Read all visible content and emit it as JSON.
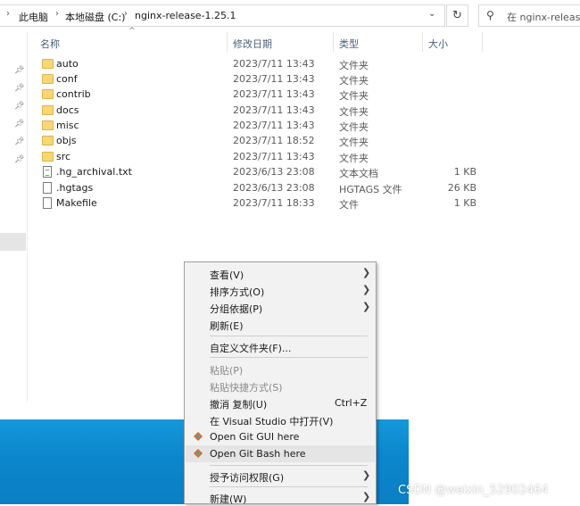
{
  "address": {
    "crumbs": [
      "此电脑",
      "本地磁盘 (C:)",
      "nginx-release-1.25.1"
    ]
  },
  "search": {
    "placeholder": "在 nginx-release-"
  },
  "columns": {
    "name": "名称",
    "date": "修改日期",
    "type": "类型",
    "size": "大小"
  },
  "files": [
    {
      "name": "auto",
      "date": "2023/7/11 13:43",
      "type": "文件夹",
      "size": "",
      "kind": "folder"
    },
    {
      "name": "conf",
      "date": "2023/7/11 13:43",
      "type": "文件夹",
      "size": "",
      "kind": "folder"
    },
    {
      "name": "contrib",
      "date": "2023/7/11 13:43",
      "type": "文件夹",
      "size": "",
      "kind": "folder"
    },
    {
      "name": "docs",
      "date": "2023/7/11 13:43",
      "type": "文件夹",
      "size": "",
      "kind": "folder"
    },
    {
      "name": "misc",
      "date": "2023/7/11 13:43",
      "type": "文件夹",
      "size": "",
      "kind": "folder"
    },
    {
      "name": "objs",
      "date": "2023/7/11 18:52",
      "type": "文件夹",
      "size": "",
      "kind": "folder"
    },
    {
      "name": "src",
      "date": "2023/7/11 13:43",
      "type": "文件夹",
      "size": "",
      "kind": "folder"
    },
    {
      "name": ".hg_archival.txt",
      "date": "2023/6/13 23:08",
      "type": "文本文档",
      "size": "1 KB",
      "kind": "text"
    },
    {
      "name": ".hgtags",
      "date": "2023/6/13 23:08",
      "type": "HGTAGS 文件",
      "size": "26 KB",
      "kind": "file"
    },
    {
      "name": "Makefile",
      "date": "2023/7/11 18:33",
      "type": "文件",
      "size": "1 KB",
      "kind": "file"
    }
  ],
  "context_menu": {
    "view": "查看(V)",
    "sort": "排序方式(O)",
    "group": "分组依据(P)",
    "refresh": "刷新(E)",
    "customize": "自定义文件夹(F)...",
    "paste": "粘贴(P)",
    "paste_shortcut": "粘贴快捷方式(S)",
    "undo_copy": "撤消 复制(U)",
    "undo_shortcut": "Ctrl+Z",
    "open_vs": "在 Visual Studio 中打开(V)",
    "git_gui": "Open Git GUI here",
    "git_bash": "Open Git Bash here",
    "grant_access": "授予访问权限(G)",
    "new": "新建(W)"
  },
  "watermark": "CSDN @weixin_52902464",
  "colors": {
    "desktop": "#0b86cc",
    "menu_bg": "#f2f2f2",
    "header_text": "#4c607a"
  }
}
